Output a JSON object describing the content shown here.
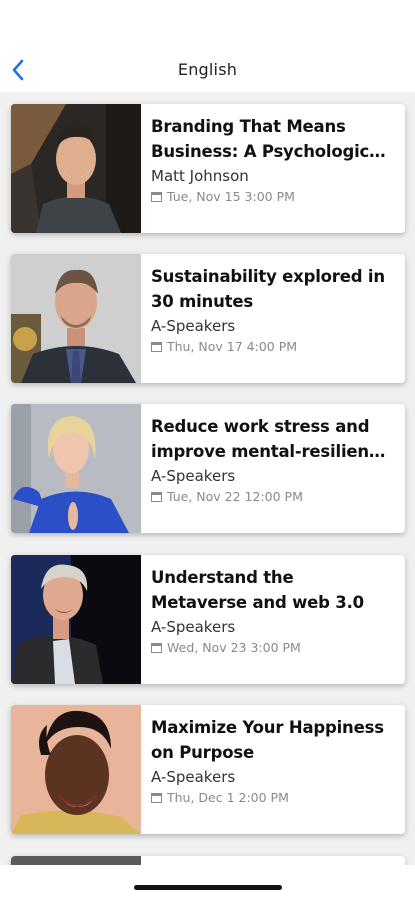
{
  "header": {
    "title": "English",
    "back_icon": "chevron-left-icon",
    "accent": "#1a73e8"
  },
  "events": [
    {
      "title": "Branding That Means Business: A Psychologic…",
      "speaker": "Matt Johnson",
      "date": "Tue, Nov 15 3:00 PM"
    },
    {
      "title": "Sustainability explored in 30 minutes",
      "speaker": "A-Speakers",
      "date": "Thu, Nov 17 4:00 PM"
    },
    {
      "title": "Reduce work stress and improve mental-resilien…",
      "speaker": "A-Speakers",
      "date": "Tue, Nov 22 12:00 PM"
    },
    {
      "title": "Understand the Metaverse and web 3.0",
      "speaker": "A-Speakers",
      "date": "Wed, Nov 23 3:00 PM"
    },
    {
      "title": "Maximize Your Happiness on Purpose",
      "speaker": "A-Speakers",
      "date": "Thu, Dec 1 2:00 PM"
    }
  ]
}
